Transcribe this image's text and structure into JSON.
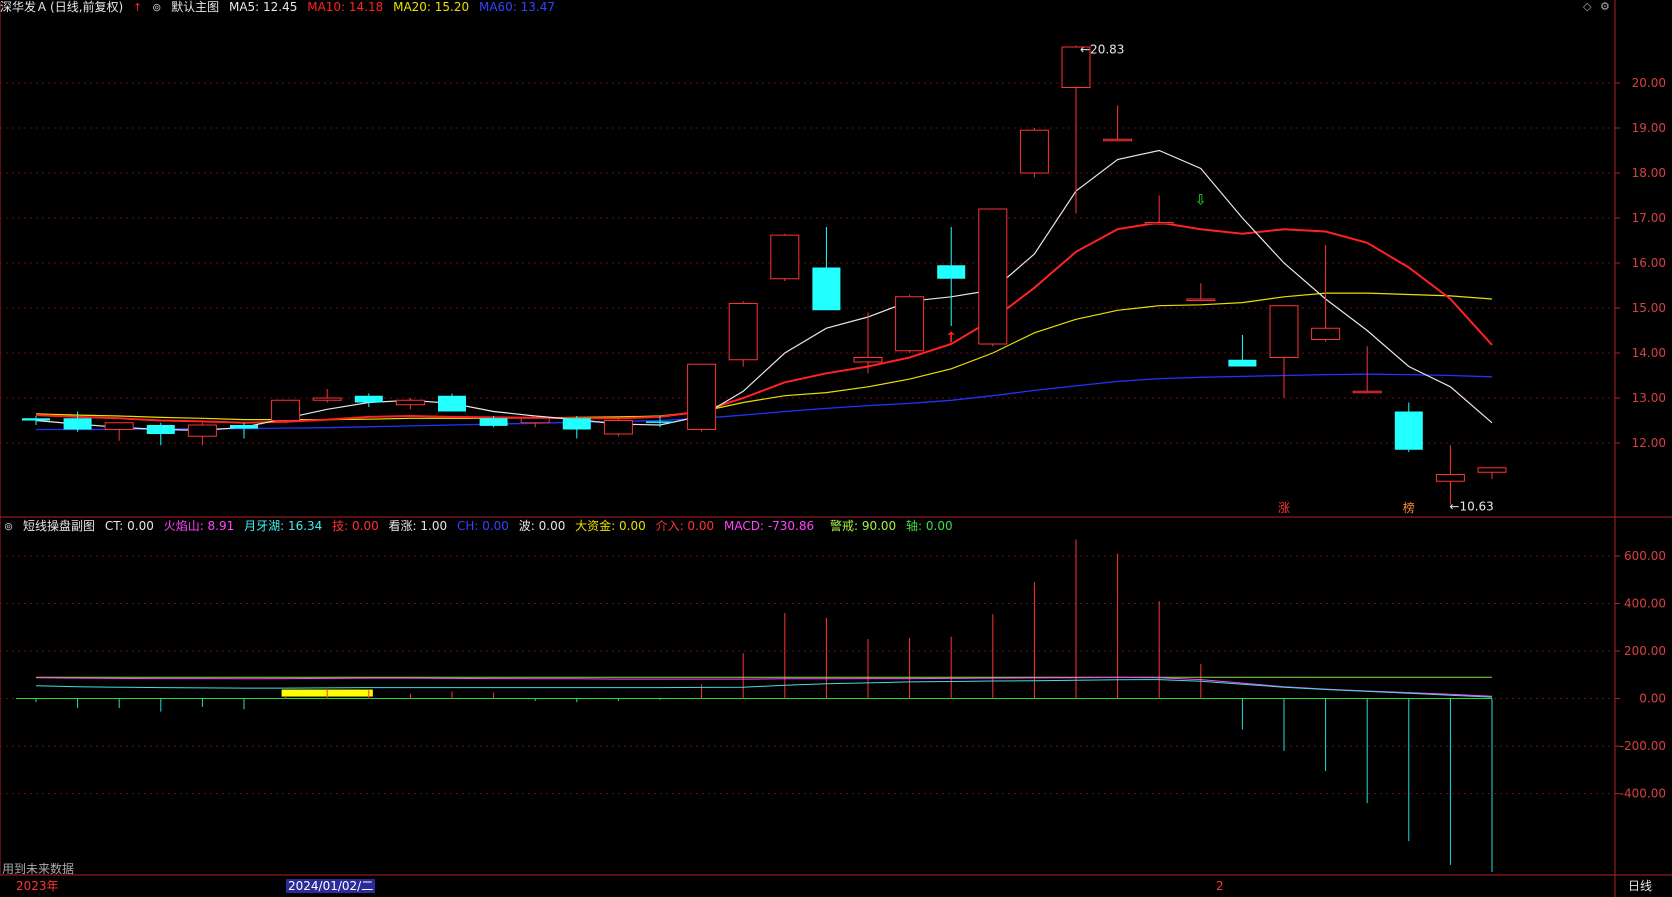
{
  "header": {
    "stock": "深华发Ａ",
    "mode": "(日线,前复权)",
    "arrow_icon": "red-up-arrow-icon",
    "template_icon": "chevron-circle-icon",
    "template": "默认主图",
    "ma5": "MA5: 12.45",
    "ma10": "MA10: 14.18",
    "ma20": "MA20: 15.20",
    "ma60": "MA60: 13.47",
    "colors": {
      "ma5": "#e6e6e6",
      "ma10": "#ff2222",
      "ma20": "#e8e000",
      "ma60": "#2233ff"
    }
  },
  "subheader": {
    "name": "短线操盘副图",
    "ct": "CT: 0.00",
    "hys": "火焰山: 8.91",
    "yyh": "月牙湖: 16.34",
    "ji": "技: 0.00",
    "kz": "看涨: 1.00",
    "ch": "CH: 0.00",
    "bo": "波: 0.00",
    "dzj": "大资金: 0.00",
    "jr": "介入: 0.00",
    "macd": "MACD: -730.86",
    "jj": "警戒: 90.00",
    "zhou": "轴: 0.00"
  },
  "annotations": {
    "high": "20.83",
    "low": "10.63",
    "tag1": "涨",
    "tag2": "榜",
    "future_note": "用到未来数据"
  },
  "bottom": {
    "year": "2023年",
    "date": "2024/01/02/二",
    "month": "2",
    "period": "日线"
  },
  "chart_data": [
    {
      "type": "candlestick",
      "yticks": [
        12.0,
        13.0,
        14.0,
        15.0,
        16.0,
        17.0,
        18.0,
        19.0,
        20.0
      ],
      "ylim": [
        10.4,
        21.4
      ],
      "candles": [
        {
          "o": 12.55,
          "h": 12.6,
          "l": 12.4,
          "c": 12.5
        },
        {
          "o": 12.55,
          "h": 12.7,
          "l": 12.25,
          "c": 12.3
        },
        {
          "o": 12.3,
          "h": 12.45,
          "l": 12.05,
          "c": 12.45
        },
        {
          "o": 12.4,
          "h": 12.45,
          "l": 11.95,
          "c": 12.2
        },
        {
          "o": 12.15,
          "h": 12.45,
          "l": 11.95,
          "c": 12.4
        },
        {
          "o": 12.4,
          "h": 12.45,
          "l": 12.1,
          "c": 12.32
        },
        {
          "o": 12.5,
          "h": 12.95,
          "l": 12.45,
          "c": 12.95
        },
        {
          "o": 12.95,
          "h": 13.2,
          "l": 12.9,
          "c": 13.0
        },
        {
          "o": 13.05,
          "h": 13.1,
          "l": 12.8,
          "c": 12.9
        },
        {
          "o": 12.85,
          "h": 13.0,
          "l": 12.75,
          "c": 12.95
        },
        {
          "o": 13.05,
          "h": 13.1,
          "l": 12.7,
          "c": 12.7
        },
        {
          "o": 12.55,
          "h": 12.6,
          "l": 12.35,
          "c": 12.38
        },
        {
          "o": 12.45,
          "h": 12.6,
          "l": 12.35,
          "c": 12.55
        },
        {
          "o": 12.55,
          "h": 12.6,
          "l": 12.1,
          "c": 12.3
        },
        {
          "o": 12.2,
          "h": 12.55,
          "l": 12.15,
          "c": 12.5
        },
        {
          "o": 12.48,
          "h": 12.6,
          "l": 12.35,
          "c": 12.45
        },
        {
          "o": 12.3,
          "h": 13.75,
          "l": 12.25,
          "c": 13.75
        },
        {
          "o": 13.85,
          "h": 15.15,
          "l": 13.7,
          "c": 15.1
        },
        {
          "o": 15.65,
          "h": 16.65,
          "l": 15.6,
          "c": 16.62
        },
        {
          "o": 15.9,
          "h": 16.8,
          "l": 14.95,
          "c": 14.95
        },
        {
          "o": 13.8,
          "h": 14.9,
          "l": 13.55,
          "c": 13.9
        },
        {
          "o": 14.05,
          "h": 15.3,
          "l": 14.0,
          "c": 15.25
        },
        {
          "o": 15.95,
          "h": 16.8,
          "l": 14.6,
          "c": 15.65
        },
        {
          "o": 14.2,
          "h": 17.2,
          "l": 14.15,
          "c": 17.2
        },
        {
          "o": 18.0,
          "h": 19.0,
          "l": 17.9,
          "c": 18.95
        },
        {
          "o": 19.9,
          "h": 20.83,
          "l": 17.1,
          "c": 20.8
        },
        {
          "o": 18.75,
          "h": 19.5,
          "l": 18.7,
          "c": 18.75
        },
        {
          "o": 16.9,
          "h": 17.5,
          "l": 16.85,
          "c": 16.9
        },
        {
          "o": 15.2,
          "h": 15.55,
          "l": 15.15,
          "c": 15.2
        },
        {
          "o": 13.85,
          "h": 14.4,
          "l": 13.7,
          "c": 13.7
        },
        {
          "o": 13.9,
          "h": 15.05,
          "l": 13.0,
          "c": 15.05
        },
        {
          "o": 14.3,
          "h": 16.4,
          "l": 14.25,
          "c": 14.55
        },
        {
          "o": 13.15,
          "h": 14.15,
          "l": 13.1,
          "c": 13.15
        },
        {
          "o": 12.7,
          "h": 12.9,
          "l": 11.8,
          "c": 11.85
        },
        {
          "o": 11.15,
          "h": 11.95,
          "l": 10.63,
          "c": 11.3
        },
        {
          "o": 11.35,
          "h": 11.45,
          "l": 11.2,
          "c": 11.45
        }
      ],
      "ma5": [
        12.5,
        12.42,
        12.35,
        12.3,
        12.28,
        12.35,
        12.55,
        12.75,
        12.9,
        12.95,
        12.88,
        12.7,
        12.6,
        12.52,
        12.42,
        12.4,
        12.6,
        13.15,
        14.0,
        14.55,
        14.8,
        15.15,
        15.25,
        15.4,
        16.2,
        17.6,
        18.3,
        18.5,
        18.1,
        17.0,
        16.0,
        15.2,
        14.5,
        13.7,
        13.25,
        12.45
      ],
      "ma10": [
        12.62,
        12.58,
        12.55,
        12.5,
        12.48,
        12.45,
        12.47,
        12.52,
        12.58,
        12.6,
        12.58,
        12.57,
        12.56,
        12.55,
        12.55,
        12.58,
        12.7,
        13.0,
        13.35,
        13.55,
        13.7,
        13.9,
        14.2,
        14.75,
        15.45,
        16.25,
        16.75,
        16.9,
        16.75,
        16.65,
        16.75,
        16.7,
        16.45,
        15.9,
        15.2,
        14.18
      ],
      "ma20": [
        12.65,
        12.62,
        12.6,
        12.57,
        12.55,
        12.52,
        12.52,
        12.52,
        12.53,
        12.55,
        12.55,
        12.55,
        12.56,
        12.57,
        12.58,
        12.6,
        12.7,
        12.9,
        13.05,
        13.12,
        13.25,
        13.42,
        13.65,
        14.0,
        14.45,
        14.75,
        14.95,
        15.05,
        15.07,
        15.12,
        15.25,
        15.33,
        15.33,
        15.3,
        15.27,
        15.2
      ],
      "ma60": [
        12.3,
        12.3,
        12.3,
        12.31,
        12.32,
        12.32,
        12.33,
        12.34,
        12.36,
        12.38,
        12.4,
        12.42,
        12.44,
        12.46,
        12.48,
        12.5,
        12.55,
        12.62,
        12.7,
        12.77,
        12.83,
        12.88,
        12.95,
        13.05,
        13.17,
        13.27,
        13.37,
        13.43,
        13.46,
        13.48,
        13.5,
        13.52,
        13.53,
        13.52,
        13.5,
        13.47
      ]
    },
    {
      "type": "bar",
      "yticks": [
        -400.0,
        -200.0,
        0.0,
        200.0,
        400.0,
        600.0
      ],
      "ylim": [
        -730,
        680
      ],
      "macd_bars": [
        -15,
        -40,
        -40,
        -55,
        -35,
        -45,
        10,
        40,
        35,
        20,
        30,
        25,
        -10,
        -15,
        -10,
        -5,
        60,
        190,
        360,
        340,
        250,
        255,
        260,
        355,
        490,
        670,
        610,
        410,
        145,
        -130,
        -220,
        -305,
        -440,
        -600,
        -700,
        -730
      ],
      "line_purple": [
        88,
        86,
        85,
        84,
        84,
        83,
        84,
        85,
        86,
        86,
        85,
        84,
        83,
        83,
        82,
        82,
        82,
        82,
        83,
        83,
        84,
        84,
        85,
        86,
        87,
        88,
        89,
        88,
        80,
        65,
        50,
        40,
        32,
        25,
        18,
        10
      ],
      "line_cyan": [
        54,
        50,
        48,
        46,
        45,
        44,
        44,
        45,
        46,
        46,
        46,
        46,
        46,
        46,
        46,
        46,
        47,
        48,
        56,
        62,
        66,
        70,
        72,
        74,
        75,
        77,
        79,
        80,
        73,
        60,
        48,
        38,
        30,
        22,
        14,
        6
      ],
      "line_green": [
        90,
        90,
        90,
        90,
        90,
        90,
        90,
        90,
        90,
        90,
        90,
        90,
        90,
        90,
        90,
        90,
        90,
        90,
        90,
        90,
        90,
        90,
        90,
        90,
        90,
        90,
        90,
        90,
        90,
        90,
        90,
        90,
        90,
        90,
        90,
        90
      ],
      "yellow_band": [
        6,
        8
      ]
    }
  ]
}
